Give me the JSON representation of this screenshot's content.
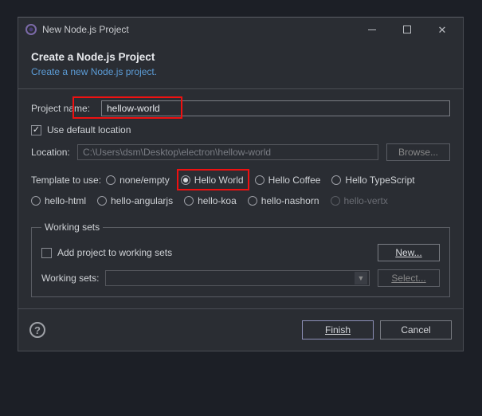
{
  "window": {
    "title": "New Node.js Project"
  },
  "header": {
    "title": "Create a Node.js Project",
    "subtitle": "Create a new Node.js project."
  },
  "project": {
    "name_label": "Project name:",
    "name_value": "hellow-world",
    "use_default_label": "Use default location",
    "use_default_checked": true,
    "location_label": "Location:",
    "location_value": "C:\\Users\\dsm\\Desktop\\electron\\hellow-world",
    "browse_label": "Browse..."
  },
  "template": {
    "label": "Template to use:",
    "options": [
      {
        "id": "none",
        "label": "none/empty",
        "selected": false
      },
      {
        "id": "hello-world",
        "label": "Hello World",
        "selected": true
      },
      {
        "id": "hello-coffee",
        "label": "Hello Coffee",
        "selected": false
      },
      {
        "id": "hello-ts",
        "label": "Hello TypeScript",
        "selected": false
      },
      {
        "id": "hello-html",
        "label": "hello-html",
        "selected": false
      },
      {
        "id": "hello-angularjs",
        "label": "hello-angularjs",
        "selected": false
      },
      {
        "id": "hello-koa",
        "label": "hello-koa",
        "selected": false
      },
      {
        "id": "hello-nashorn",
        "label": "hello-nashorn",
        "selected": false
      },
      {
        "id": "hello-vertx",
        "label": "hello-vertx",
        "selected": false,
        "disabled": true
      }
    ]
  },
  "working_sets": {
    "legend": "Working sets",
    "add_label": "Add project to working sets",
    "new_label": "New...",
    "ws_label": "Working sets:",
    "select_label": "Select..."
  },
  "footer": {
    "finish": "Finish",
    "cancel": "Cancel"
  }
}
